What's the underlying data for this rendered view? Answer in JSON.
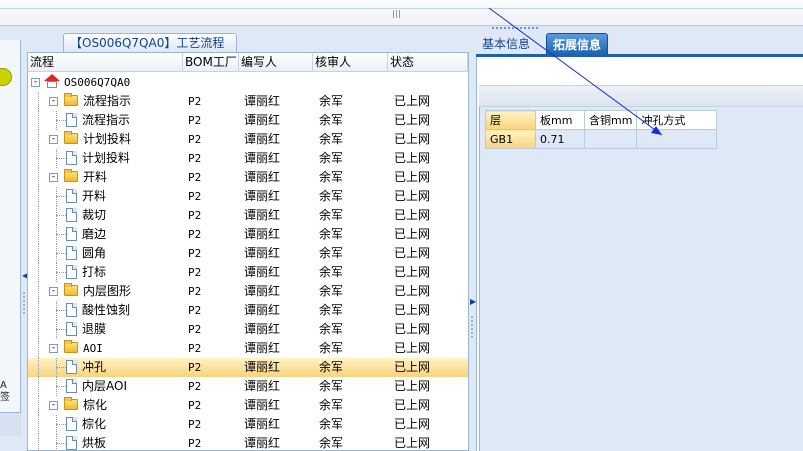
{
  "mid_tab_title": "【OS006Q7QA0】工艺流程",
  "grid": {
    "headers": [
      "流程",
      "BOM工厂",
      "编写人",
      "核审人",
      "状态"
    ],
    "rows": [
      {
        "level": 0,
        "kind": "root",
        "toggle": "-",
        "label": "OS006Q7QA0",
        "bom": "",
        "writer": "",
        "reviewer": "",
        "status": "",
        "selected": false
      },
      {
        "level": 1,
        "kind": "folder",
        "toggle": "-",
        "label": "流程指示",
        "bom": "P2",
        "writer": "谭丽红",
        "reviewer": "余军",
        "status": "已上网",
        "selected": false
      },
      {
        "level": 2,
        "kind": "doc",
        "toggle": "",
        "label": "流程指示",
        "bom": "P2",
        "writer": "谭丽红",
        "reviewer": "余军",
        "status": "已上网",
        "selected": false
      },
      {
        "level": 1,
        "kind": "folder",
        "toggle": "-",
        "label": "计划投料",
        "bom": "P2",
        "writer": "谭丽红",
        "reviewer": "余军",
        "status": "已上网",
        "selected": false
      },
      {
        "level": 2,
        "kind": "doc",
        "toggle": "",
        "label": "计划投料",
        "bom": "P2",
        "writer": "谭丽红",
        "reviewer": "余军",
        "status": "已上网",
        "selected": false
      },
      {
        "level": 1,
        "kind": "folder",
        "toggle": "-",
        "label": "开料",
        "bom": "P2",
        "writer": "谭丽红",
        "reviewer": "余军",
        "status": "已上网",
        "selected": false
      },
      {
        "level": 2,
        "kind": "doc",
        "toggle": "",
        "label": "开料",
        "bom": "P2",
        "writer": "谭丽红",
        "reviewer": "余军",
        "status": "已上网",
        "selected": false
      },
      {
        "level": 2,
        "kind": "doc",
        "toggle": "",
        "label": "裁切",
        "bom": "P2",
        "writer": "谭丽红",
        "reviewer": "余军",
        "status": "已上网",
        "selected": false
      },
      {
        "level": 2,
        "kind": "doc",
        "toggle": "",
        "label": "磨边",
        "bom": "P2",
        "writer": "谭丽红",
        "reviewer": "余军",
        "status": "已上网",
        "selected": false
      },
      {
        "level": 2,
        "kind": "doc",
        "toggle": "",
        "label": "圆角",
        "bom": "P2",
        "writer": "谭丽红",
        "reviewer": "余军",
        "status": "已上网",
        "selected": false
      },
      {
        "level": 2,
        "kind": "doc",
        "toggle": "",
        "label": "打标",
        "bom": "P2",
        "writer": "谭丽红",
        "reviewer": "余军",
        "status": "已上网",
        "selected": false
      },
      {
        "level": 1,
        "kind": "folder",
        "toggle": "-",
        "label": "内层图形",
        "bom": "P2",
        "writer": "谭丽红",
        "reviewer": "余军",
        "status": "已上网",
        "selected": false
      },
      {
        "level": 2,
        "kind": "doc",
        "toggle": "",
        "label": "酸性蚀刻",
        "bom": "P2",
        "writer": "谭丽红",
        "reviewer": "余军",
        "status": "已上网",
        "selected": false
      },
      {
        "level": 2,
        "kind": "doc",
        "toggle": "",
        "label": "退膜",
        "bom": "P2",
        "writer": "谭丽红",
        "reviewer": "余军",
        "status": "已上网",
        "selected": false
      },
      {
        "level": 1,
        "kind": "folder",
        "toggle": "-",
        "label": "AOI",
        "bom": "P2",
        "writer": "谭丽红",
        "reviewer": "余军",
        "status": "已上网",
        "selected": false
      },
      {
        "level": 2,
        "kind": "doc",
        "toggle": "",
        "label": "冲孔",
        "bom": "P2",
        "writer": "谭丽红",
        "reviewer": "余军",
        "status": "已上网",
        "selected": true
      },
      {
        "level": 2,
        "kind": "doc",
        "toggle": "",
        "label": "内层AOI",
        "bom": "P2",
        "writer": "谭丽红",
        "reviewer": "余军",
        "status": "已上网",
        "selected": false
      },
      {
        "level": 1,
        "kind": "folder",
        "toggle": "-",
        "label": "棕化",
        "bom": "P2",
        "writer": "谭丽红",
        "reviewer": "余军",
        "status": "已上网",
        "selected": false
      },
      {
        "level": 2,
        "kind": "doc",
        "toggle": "",
        "label": "棕化",
        "bom": "P2",
        "writer": "谭丽红",
        "reviewer": "余军",
        "status": "已上网",
        "selected": false
      },
      {
        "level": 2,
        "kind": "doc",
        "toggle": "",
        "label": "烘板",
        "bom": "P2",
        "writer": "谭丽红",
        "reviewer": "余军",
        "status": "已上网",
        "selected": false
      }
    ]
  },
  "right": {
    "tab_basic": "基本信息",
    "tab_ext": "拓展信息",
    "table": {
      "headers": [
        "层",
        "板mm",
        "含铜mm",
        "冲孔方式"
      ],
      "rows": [
        [
          "GB1",
          "0.71",
          "",
          ""
        ]
      ]
    }
  },
  "left_small_text": [
    "A",
    "签"
  ]
}
